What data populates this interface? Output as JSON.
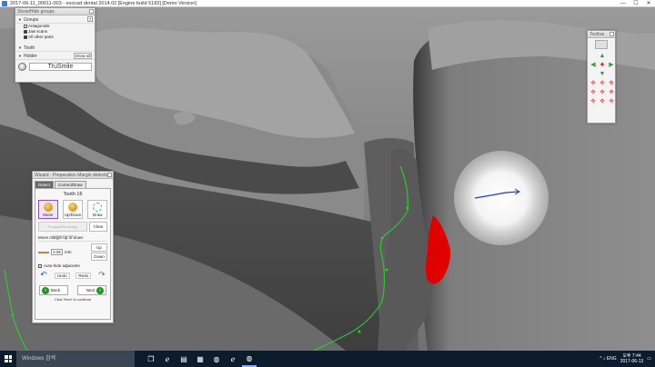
{
  "window": {
    "title": "2017-06-11_00011-003 - exocad dental 2014.02 [Engine build 5183] [Demo Version]",
    "minimize": "—",
    "maximize": "☐",
    "close": "✕"
  },
  "groups_panel": {
    "caption": "Show/Hide groups",
    "sections": {
      "groups": "Groups",
      "tooth": "Tooth",
      "holder": "Holder"
    },
    "help": "?",
    "items": [
      "Antagonists",
      "Jaw scans",
      "All other parts"
    ],
    "show_all": "Show all",
    "trusmile": "TruSmile"
  },
  "toolbar": {
    "caption": "Toolbar",
    "icons": [
      "view-cube-icon",
      "arrow-up-icon",
      "arrow-left-icon",
      "arrow-right-icon",
      "arrow-down-icon",
      "rotate-view-icon"
    ]
  },
  "wizard": {
    "caption": "Wizard - Preparation Margin detection",
    "tabs": [
      "Detect",
      "Correct/Draw"
    ],
    "tooth_title": "Tooth 16",
    "tools": [
      "Move",
      "Up/Down",
      "Draw"
    ],
    "propose": "Propose/Redesign Automatically",
    "clear": "Clear",
    "move_label": "Move margin up or down",
    "move_value": "0.05",
    "unit": "mm",
    "up": "Up",
    "down": "Down",
    "auto_hide": "Auto-hide adjacents",
    "undo": "Undo",
    "redo": "Redo",
    "back": "Back",
    "next": "Next",
    "hint": "Click 'Next' to continue"
  },
  "taskbar": {
    "search_placeholder": "Windows 검색",
    "time": "오후 7:44",
    "date": "2017-06-13",
    "tray_label": "^  ♪  ENG"
  },
  "colors": {
    "margin_line": "#2fc82f",
    "preparation_area": "#e00000",
    "cursor_stroke": "#1a3fd0"
  }
}
